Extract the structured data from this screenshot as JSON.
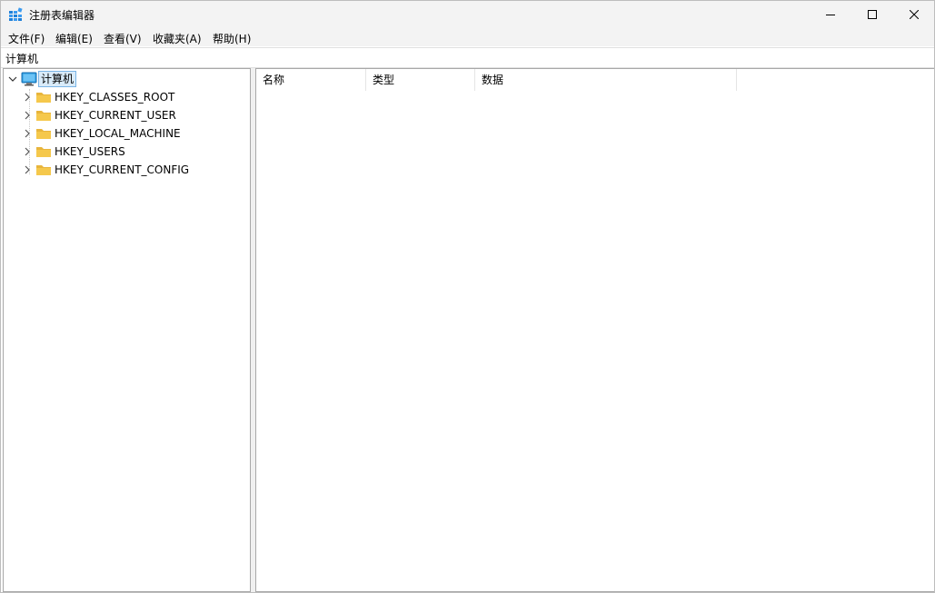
{
  "window": {
    "title": "注册表编辑器"
  },
  "menu": {
    "file": "文件(F)",
    "edit": "编辑(E)",
    "view": "查看(V)",
    "favorites": "收藏夹(A)",
    "help": "帮助(H)"
  },
  "address": {
    "path": "计算机"
  },
  "tree": {
    "root": "计算机",
    "keys": [
      "HKEY_CLASSES_ROOT",
      "HKEY_CURRENT_USER",
      "HKEY_LOCAL_MACHINE",
      "HKEY_USERS",
      "HKEY_CURRENT_CONFIG"
    ]
  },
  "list": {
    "columns": [
      "名称",
      "类型",
      "数据"
    ]
  },
  "colors": {
    "titlebar_bg": "#f3f3f3",
    "folder_yellow": "#f5c84c",
    "selection_bg": "#d9ebf9",
    "selection_border": "#7ab4e5",
    "computer_blue": "#2b9be0"
  },
  "icons": {
    "app": "registry-editor-icon",
    "root": "computer-icon",
    "key": "folder-icon"
  }
}
